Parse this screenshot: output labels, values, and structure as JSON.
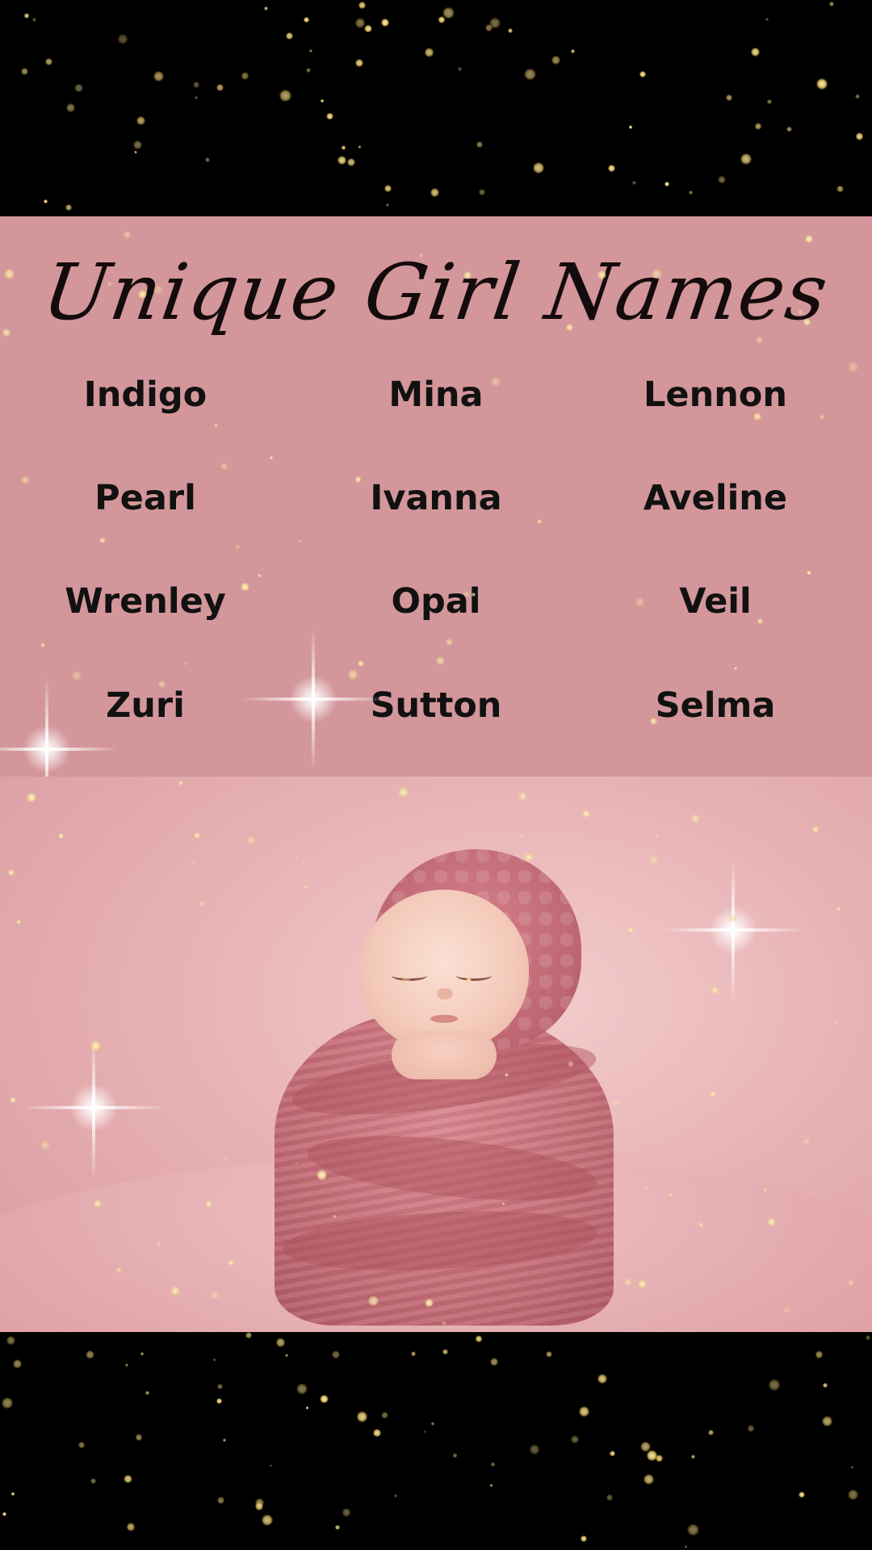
{
  "title": "Unique Girl Names",
  "names": [
    [
      "Indigo",
      "Mina",
      "Lennon"
    ],
    [
      "Pearl",
      "Ivanna",
      "Aveline"
    ],
    [
      "Wrenley",
      "Opal",
      "Veil"
    ],
    [
      "Zuri",
      "Sutton",
      "Selma"
    ]
  ],
  "colors": {
    "panel": "#d3969a",
    "background": "#000000",
    "glitter": "#e3c25c",
    "text": "#111111"
  },
  "photo": {
    "subject": "sleeping newborn wrapped in pink knit blanket with bonnet"
  }
}
